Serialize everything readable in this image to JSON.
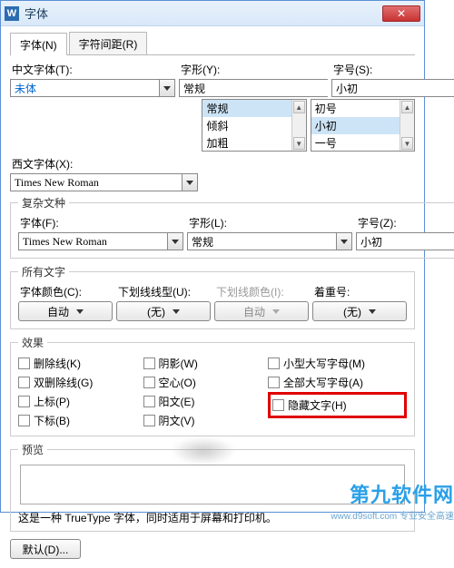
{
  "window": {
    "title": "字体",
    "close_glyph": "✕"
  },
  "tabs": [
    {
      "label": "字体(N)",
      "active": true
    },
    {
      "label": "字符间距(R)",
      "active": false
    }
  ],
  "upper": {
    "cn_font_label": "中文字体(T):",
    "cn_font_value": "未体",
    "style_label": "字形(Y):",
    "style_value": "常规",
    "style_items": [
      "常规",
      "倾斜",
      "加粗"
    ],
    "size_label": "字号(S):",
    "size_value": "小初",
    "size_items": [
      "初号",
      "小初",
      "一号"
    ],
    "west_font_label": "西文字体(X):",
    "west_font_value": "Times New Roman"
  },
  "complex": {
    "legend": "复杂文种",
    "font_label": "字体(F):",
    "font_value": "Times New Roman",
    "style_label": "字形(L):",
    "style_value": "常规",
    "size_label": "字号(Z):",
    "size_value": "小初"
  },
  "alltext": {
    "legend": "所有文字",
    "color_label": "字体颜色(C):",
    "color_value": "自动",
    "uline_label": "下划线线型(U):",
    "uline_value": "(无)",
    "ucolor_label": "下划线颜色(I):",
    "ucolor_value": "自动",
    "emph_label": "着重号:",
    "emph_value": "(无)"
  },
  "effects": {
    "legend": "效果",
    "col1": [
      {
        "label": "删除线(K)"
      },
      {
        "label": "双删除线(G)"
      },
      {
        "label": "上标(P)"
      },
      {
        "label": "下标(B)"
      }
    ],
    "col2": [
      {
        "label": "阴影(W)"
      },
      {
        "label": "空心(O)"
      },
      {
        "label": "阳文(E)"
      },
      {
        "label": "阴文(V)"
      }
    ],
    "col3": [
      {
        "label": "小型大写字母(M)"
      },
      {
        "label": "全部大写字母(A)"
      },
      {
        "label": "隐藏文字(H)"
      }
    ]
  },
  "preview": {
    "legend": "预览",
    "note": "这是一种 TrueType 字体，同时适用于屏幕和打印机。"
  },
  "footer": {
    "default_btn": "默认(D)..."
  },
  "watermark": {
    "line1": "第九软件网",
    "line2": "www.d9soft.com 专业安全高速"
  }
}
